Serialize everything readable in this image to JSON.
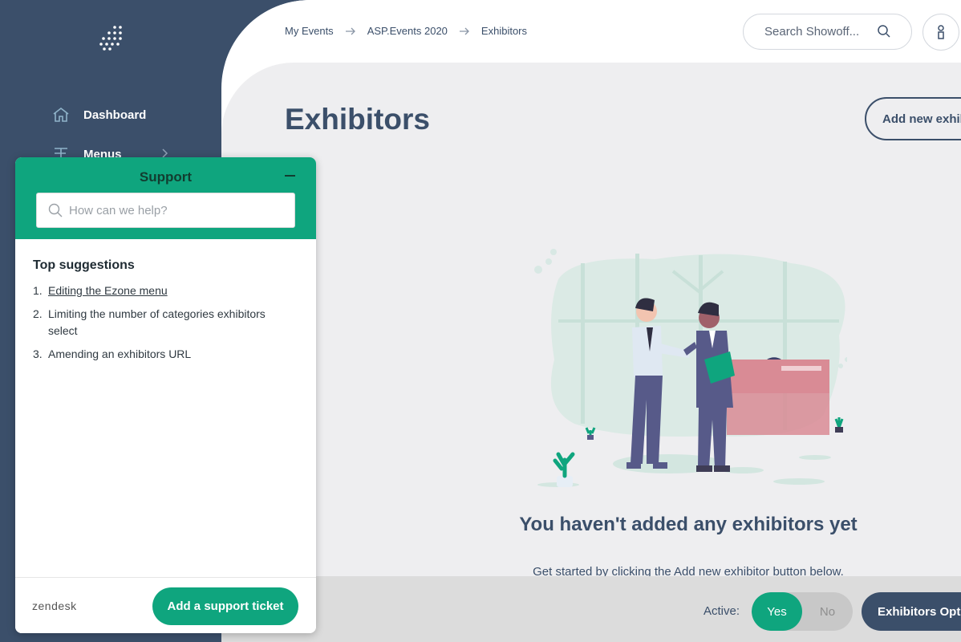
{
  "sidebar": {
    "logo_icon": "dots-grid-logo-icon",
    "items": [
      {
        "label": "Dashboard",
        "icon": "home-icon"
      },
      {
        "label": "Menus",
        "icon": "signpost-icon"
      }
    ]
  },
  "breadcrumb": [
    "My Events",
    "ASP.Events 2020",
    "Exhibitors"
  ],
  "search": {
    "placeholder": "Search Showoff..."
  },
  "page": {
    "title": "Exhibitors",
    "add_button": "Add new exhibitor",
    "empty_title": "You haven't added any exhibitors yet",
    "empty_sub": "Get started by clicking the Add new exhibitor button below."
  },
  "bottombar": {
    "active_label": "Active:",
    "yes": "Yes",
    "no": "No",
    "options_button": "Exhibitors Options"
  },
  "support": {
    "title": "Support",
    "search_placeholder": "How can we help?",
    "top_title": "Top suggestions",
    "suggestions": [
      {
        "num": "1.",
        "text": "Editing the Ezone menu"
      },
      {
        "num": "2.",
        "text": "Limiting the number of categories exhibitors select"
      },
      {
        "num": "3.",
        "text": "Amending an exhibitors URL"
      }
    ],
    "brand": "zendesk",
    "ticket_button": "Add a support ticket"
  },
  "colors": {
    "navy": "#3b4f6a",
    "green": "#0fa57e",
    "grey_bg": "#eeeef0"
  }
}
